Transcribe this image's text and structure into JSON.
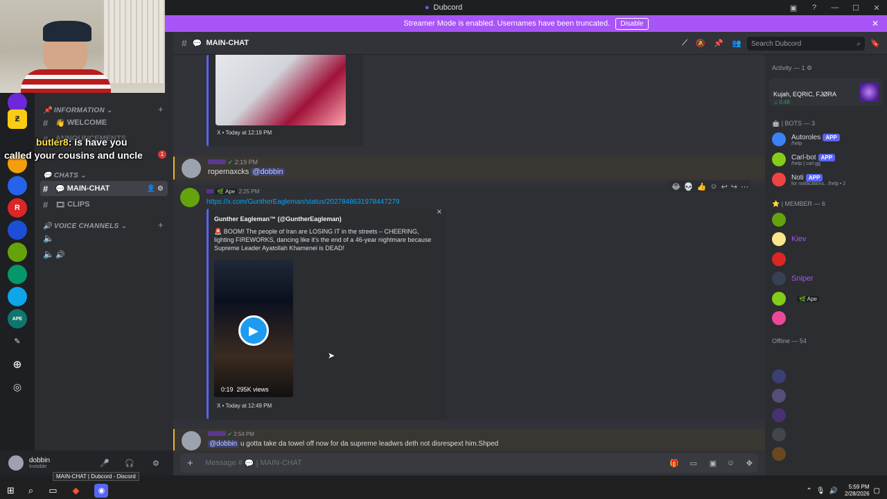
{
  "app": {
    "title": "Dubcord",
    "window_controls": [
      "—",
      "☐",
      "✕"
    ]
  },
  "streamer_banner": {
    "text": "Streamer Mode is enabled. Usernames have been truncated.",
    "button": "Disable"
  },
  "overlay": {
    "chat_user": "butler8",
    "chat_text": "is have you called your cousins and uncle"
  },
  "channels": {
    "categories": {
      "information": "INFORMATION",
      "chats": "CHATS",
      "voice": "VOICE CHANNELS"
    },
    "welcome": "WELCOME",
    "announcements": "ANNOUNCEMENTS",
    "main_chat": "MAIN-CHAT",
    "clips": "CLIPS",
    "unread_badge": "1"
  },
  "user": {
    "name": "dobbin",
    "status": "Invisible",
    "tooltip": "MAIN-CHAT | Dubcord - Discord"
  },
  "header": {
    "channel": "MAIN-CHAT",
    "search_placeholder": "Search Dubcord"
  },
  "messages": {
    "embed1_footer": "X • Today at 12:19 PM",
    "m2_time": "2:19 PM",
    "m2_text": "ropemaxcks",
    "m2_mention": "@dobbin",
    "m3_tag": "Ape",
    "m3_time": "2:25 PM",
    "m3_link": "https://x.com/GuntherEagleman/status/2027848631978447279",
    "embed_author": "Gunther Eagleman™ (@GuntherEagleman)",
    "embed_text": "🚨 BOOM! The people of Iran are LOSING IT in the streets – CHEERING, lighting FIREWORKS, dancing like it's the end of a 46-year nightmare because Supreme Leader Ayatollah Khamenei is DEAD!",
    "video_duration": "0:19",
    "video_views": "295K views",
    "embed2_footer": "X • Today at 12:49 PM",
    "m4_time": "2:54 PM",
    "m4_mention": "@dobbin",
    "m4_text": "u gotta take da towel off now for da supreme leadwrs deth not disrespext him.Shped"
  },
  "composer": {
    "placeholder": "Message #",
    "channel": "MAIN-CHAT"
  },
  "members": {
    "activity_header": "Activity — 1",
    "activity_names": "Kujah, EQRIC, FJØRA",
    "activity_time": "0:48",
    "bots_header": "BOTS — 3",
    "bots": [
      {
        "name": "Autoroles",
        "sub": "/help",
        "badge": "APP",
        "color": "#3b82f6"
      },
      {
        "name": "Carl-bot",
        "sub": "/help | carl.gg",
        "badge": "APP",
        "color": "#84cc16"
      },
      {
        "name": "Noti",
        "sub": "for notifications.. /help • 2",
        "badge": "APP",
        "color": "#ef4444"
      }
    ],
    "member_header": "MEMBER — 6",
    "member_names": [
      "",
      "Kiev",
      "",
      "Sniper",
      "",
      ""
    ],
    "member_tag": "Ape",
    "offline_header": "Offline — 54"
  },
  "taskbar": {
    "time": "5:59 PM",
    "date": "2/28/2026"
  }
}
